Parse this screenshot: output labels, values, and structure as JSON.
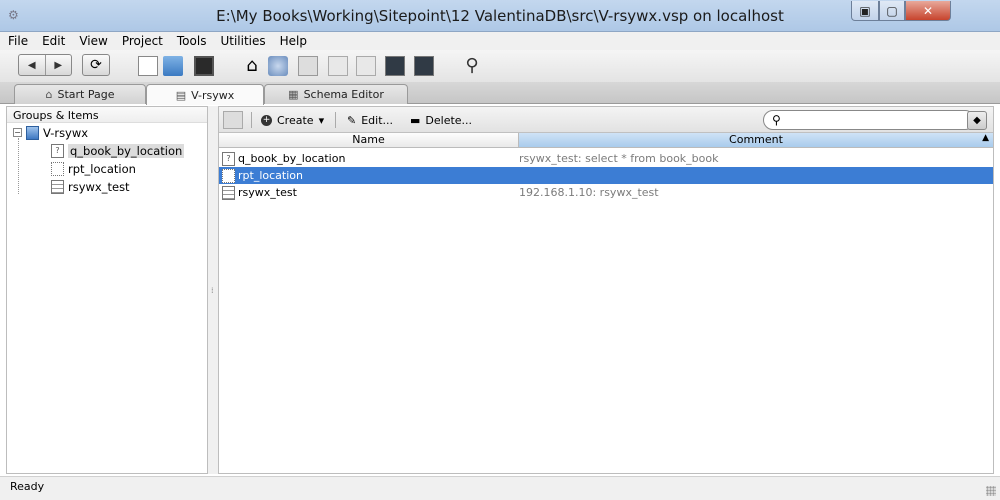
{
  "window": {
    "title": "E:\\My Books\\Working\\Sitepoint\\12 ValentinaDB\\src\\V-rsywx.vsp on localhost",
    "min_glyph": "▣",
    "max_glyph": "▢",
    "close_glyph": "✕"
  },
  "menu": [
    "File",
    "Edit",
    "View",
    "Project",
    "Tools",
    "Utilities",
    "Help"
  ],
  "toolbar": {
    "back_glyph": "◀",
    "forward_glyph": "▶",
    "refresh_glyph": "⟳",
    "home_glyph": "⌂",
    "connect_glyph": "⚲"
  },
  "tabs": [
    {
      "label": "Start Page",
      "icon": "home-icon"
    },
    {
      "label": "V-rsywx",
      "icon": "document-icon"
    },
    {
      "label": "Schema Editor",
      "icon": "schema-icon"
    }
  ],
  "left_panel": {
    "header": "Groups & Items",
    "root": "V-rsywx",
    "expander": "−",
    "items": [
      {
        "label": "q_book_by_location",
        "icon": "query-icon"
      },
      {
        "label": "rpt_location",
        "icon": "report-icon"
      },
      {
        "label": "rsywx_test",
        "icon": "table-icon"
      }
    ]
  },
  "right_toolbar": {
    "create_label": "Create",
    "create_dropdown": "▾",
    "edit_label": "Edit...",
    "delete_label": "Delete...",
    "search_placeholder": "",
    "search_glyph": "🔍"
  },
  "table": {
    "columns": [
      "Name",
      "Comment"
    ],
    "sort_glyph": "▲",
    "rows": [
      {
        "name": "q_book_by_location",
        "comment": "rsywx_test: select * from book_book"
      },
      {
        "name": "rpt_location",
        "comment": ""
      },
      {
        "name": "rsywx_test",
        "comment": "192.168.1.10: rsywx_test"
      }
    ],
    "selected_row": 1
  },
  "status": "Ready",
  "colors": {
    "selection": "#3c7dd4",
    "titlebar": "#b8cfea"
  }
}
